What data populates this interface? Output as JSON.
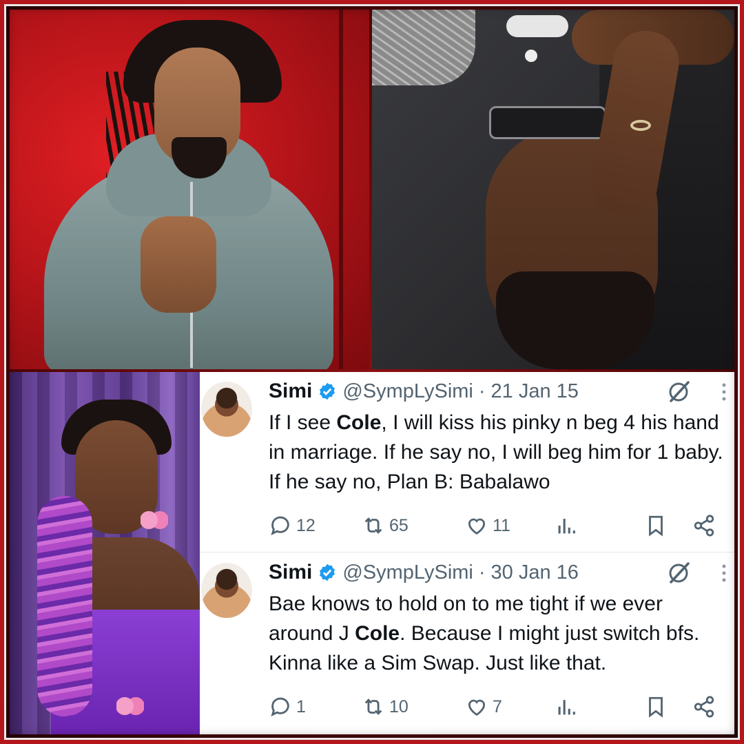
{
  "tweets": [
    {
      "name": "Simi",
      "handle": "@SympLySimi",
      "separator": "·",
      "date": "21 Jan 15",
      "text_before": "If I see ",
      "text_bold": "Cole",
      "text_after": ", I will kiss his pinky n beg 4 his hand in marriage. If he say no, I will beg him for 1 baby. If he say no, Plan B: Babalawo",
      "replies": "12",
      "retweets": "65",
      "likes": "11"
    },
    {
      "name": "Simi",
      "handle": "@SympLySimi",
      "separator": "·",
      "date": "30 Jan 16",
      "text_before": "Bae knows to hold on to me tight if we ever around J ",
      "text_bold": "Cole",
      "text_after": ". Because I might just switch bfs. Kinna like a Sim Swap. Just like that.",
      "replies": "1",
      "retweets": "10",
      "likes": "7"
    }
  ],
  "colors": {
    "verified_badge": "#1d9bf0",
    "text_primary": "#0f1419",
    "text_secondary": "#536471",
    "frame": "#b3171b"
  },
  "icons": [
    "verified-badge-icon",
    "grok-icon",
    "more-icon",
    "reply-icon",
    "retweet-icon",
    "like-icon",
    "views-icon",
    "bookmark-icon",
    "share-icon"
  ]
}
